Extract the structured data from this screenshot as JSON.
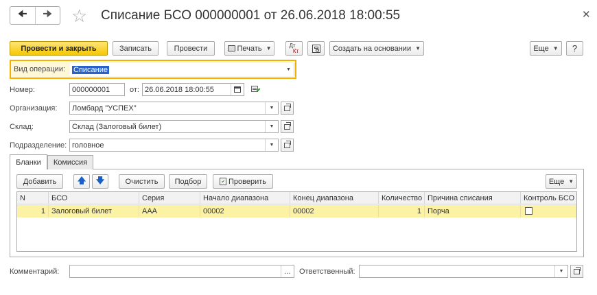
{
  "window": {
    "title": "Списание БСО 000000001 от 26.06.2018 18:00:55",
    "nav_back_icon": "arrow-left-icon",
    "nav_forward_icon": "arrow-right-icon",
    "star_icon": "star-icon",
    "close_icon": "close-icon"
  },
  "toolbar": {
    "post_close": "Провести и закрыть",
    "save": "Записать",
    "post": "Провести",
    "print": "Печать",
    "dt_kt_top": "Дт",
    "dt_kt_bottom": "Кт",
    "create_based": "Создать на основании",
    "more": "Еще",
    "help": "?"
  },
  "form": {
    "operation_label": "Вид операции:",
    "operation_value": "Списание",
    "number_label": "Номер:",
    "number_value": "000000001",
    "date_label": "от:",
    "date_value": "26.06.2018 18:00:55",
    "org_label": "Организация:",
    "org_value": "Ломбард \"УСПЕХ\"",
    "warehouse_label": "Склад:",
    "warehouse_value": "Склад (Залоговый билет)",
    "division_label": "Подразделение:",
    "division_value": "головное"
  },
  "tabs": [
    {
      "label": "Бланки",
      "active": true
    },
    {
      "label": "Комиссия",
      "active": false
    }
  ],
  "table_toolbar": {
    "add": "Добавить",
    "clear": "Очистить",
    "pick": "Подбор",
    "check": "Проверить",
    "more": "Еще"
  },
  "table": {
    "columns": [
      "N",
      "БСО",
      "Серия",
      "Начало диапазона",
      "Конец диапазона",
      "Количество",
      "Причина списания",
      "Контроль БСО"
    ],
    "rows": [
      {
        "n": "1",
        "bso": "Залоговый билет",
        "series": "ААА",
        "start": "00002",
        "end": "00002",
        "qty": "1",
        "reason": "Порча",
        "control": false
      }
    ]
  },
  "footer": {
    "comment_label": "Комментарий:",
    "comment_value": "",
    "comment_btn": "...",
    "responsible_label": "Ответственный:",
    "responsible_value": ""
  },
  "colors": {
    "primary_button": "#f5c800",
    "selected_row": "#fbf2a4",
    "focus_border": "#f4b000",
    "selection": "#2a63c5",
    "arrow_blue": "#1a5fc8"
  }
}
